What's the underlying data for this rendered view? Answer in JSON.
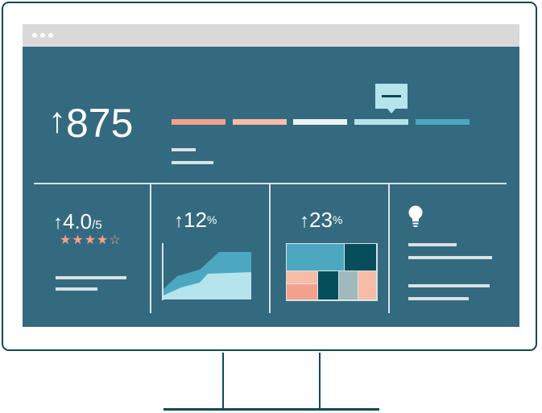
{
  "hero": {
    "arrow": "↑",
    "value": "875"
  },
  "kpis": [
    {
      "arrow": "↑",
      "value": "4.0",
      "suffix": "/5",
      "stars": "★★★★☆",
      "rating": 4,
      "rating_max": 5
    },
    {
      "arrow": "↑",
      "value": "12",
      "suffix": "%"
    },
    {
      "arrow": "↑",
      "value": "23",
      "suffix": "%"
    }
  ],
  "icons": {
    "idea": "lightbulb-icon",
    "tooltip": "tooltip-icon"
  },
  "colors": {
    "screen_bg": "#346a7f",
    "frame": "#0d4a52",
    "coral": "#f4a08c",
    "peach": "#f7bca8",
    "white_bar": "#eef2f3",
    "light_teal": "#b6e4ec",
    "teal": "#4ba8c0",
    "dark_teal": "#074e5c",
    "grey_bar": "#d9d9d9"
  }
}
